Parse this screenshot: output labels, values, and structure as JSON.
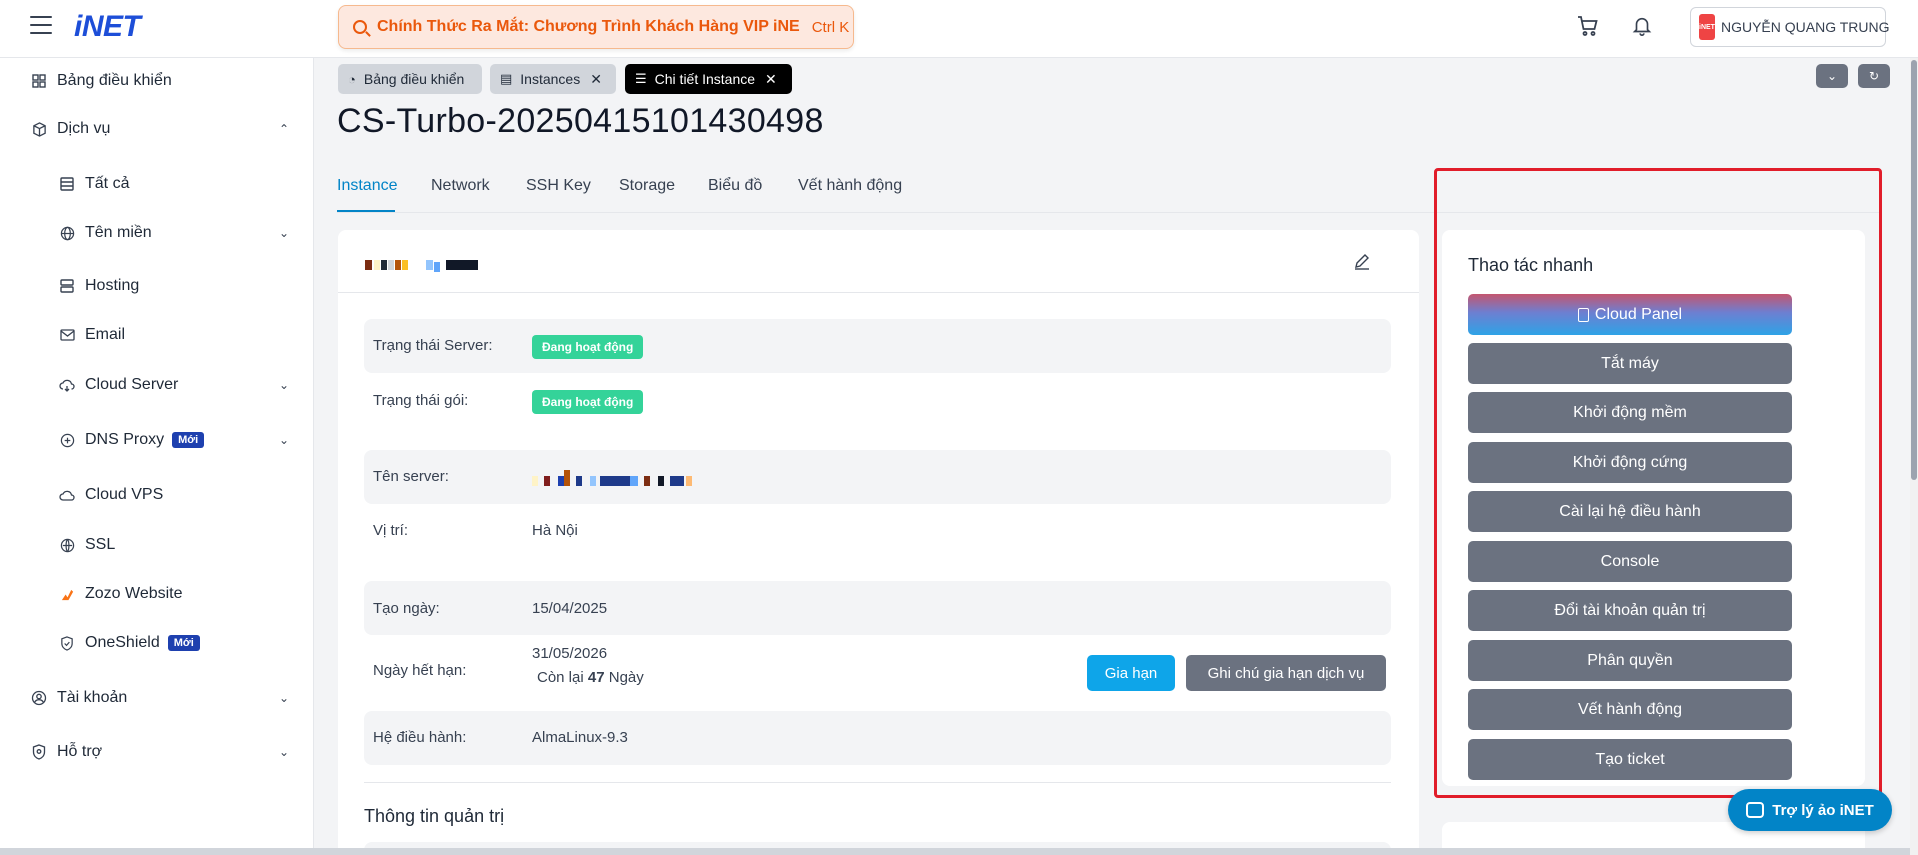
{
  "header": {
    "logo": "iNET",
    "search_text": "Chính Thức Ra Mắt: Chương Trình Khách Hàng VIP iNE",
    "search_shortcut": "Ctrl K",
    "user_logo": "iNET",
    "user_name": "NGUYỄN QUANG TRUNG"
  },
  "sidebar": {
    "items": [
      {
        "label": "Bảng điều khiển",
        "icon": "dashboard-icon"
      },
      {
        "label": "Dịch vụ",
        "icon": "cube-icon"
      },
      {
        "label": "Tất cả",
        "icon": "table-icon"
      },
      {
        "label": "Tên miền",
        "icon": "globe-icon"
      },
      {
        "label": "Hosting",
        "icon": "server-icon"
      },
      {
        "label": "Email",
        "icon": "mail-icon"
      },
      {
        "label": "Cloud Server",
        "icon": "cloud-icon"
      },
      {
        "label": "DNS Proxy",
        "icon": "dns-icon",
        "badge": "Mới"
      },
      {
        "label": "Cloud VPS",
        "icon": "cloud-outline-icon"
      },
      {
        "label": "SSL",
        "icon": "ssl-icon"
      },
      {
        "label": "Zozo Website",
        "icon": "zozo-icon"
      },
      {
        "label": "OneShield",
        "icon": "shield-icon",
        "badge": "Mới"
      },
      {
        "label": "Tài khoản",
        "icon": "user-circle-icon"
      },
      {
        "label": "Hỗ trợ",
        "icon": "support-icon"
      }
    ]
  },
  "top_tabs": [
    {
      "label": "Bảng điều khiển"
    },
    {
      "label": "Instances"
    },
    {
      "label": "Chi tiết Instance"
    }
  ],
  "page_title": "CS-Turbo-20250415101430498",
  "content_tabs": [
    "Instance",
    "Network",
    "SSH Key",
    "Storage",
    "Biểu đồ",
    "Vết hành động"
  ],
  "details": {
    "server_status_label": "Trạng thái Server:",
    "server_status_value": "Đang hoạt động",
    "package_status_label": "Trạng thái gói:",
    "package_status_value": "Đang hoạt động",
    "server_name_label": "Tên server:",
    "location_label": "Vị trí:",
    "location_value": "Hà Nội",
    "created_label": "Tạo ngày:",
    "created_value": "15/04/2025",
    "expiry_label": "Ngày hết hạn:",
    "expiry_value": "31/05/2026",
    "remaining_prefix": "Còn lại",
    "remaining_days": "47",
    "remaining_suffix": "Ngày",
    "renew_button": "Gia hạn",
    "renew_note_button": "Ghi chú gia hạn dịch vụ",
    "os_label": "Hệ điều hành:",
    "os_value": "AlmaLinux-9.3",
    "admin_section_title": "Thông tin quản trị"
  },
  "quick_actions": {
    "title": "Thao tác nhanh",
    "buttons": [
      "Cloud Panel",
      "Tắt máy",
      "Khởi động mềm",
      "Khởi động cứng",
      "Cài lại hệ điều hành",
      "Console",
      "Đổi tài khoản quản trị",
      "Phân quyền",
      "Vết hành động",
      "Tạo ticket"
    ]
  },
  "assistant": {
    "label": "Trợ lý ảo iNET"
  },
  "colors": {
    "accent": "#0284c7",
    "status_green": "#34d399",
    "highlight_red": "#e11d2a",
    "search_orange": "#ea580c"
  }
}
